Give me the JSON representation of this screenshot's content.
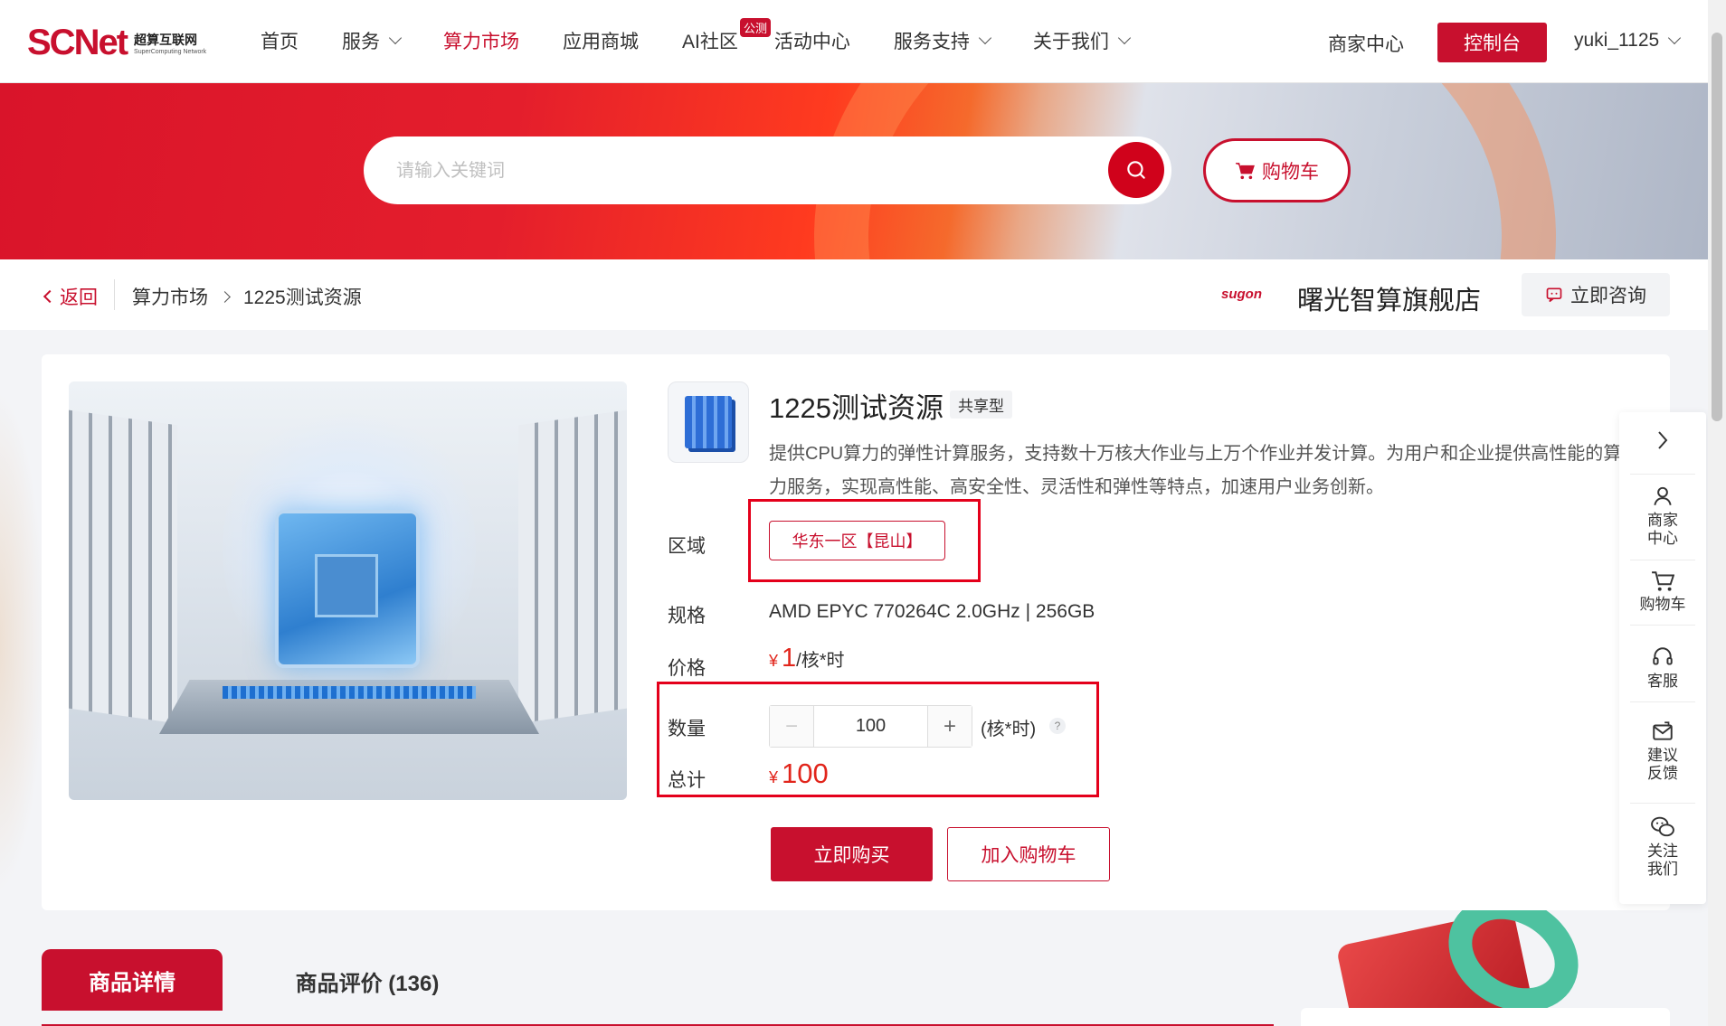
{
  "header": {
    "logo_text": "SCNet",
    "logo_cn": "超算互联网",
    "logo_en": "SuperComputing Network",
    "nav": [
      {
        "label": "首页"
      },
      {
        "label": "服务"
      },
      {
        "label": "算力市场"
      },
      {
        "label": "应用商城"
      },
      {
        "label": "AI社区"
      },
      {
        "label": "活动中心"
      },
      {
        "label": "服务支持"
      },
      {
        "label": "关于我们"
      }
    ],
    "ai_badge": "公测",
    "merchant_center": "商家中心",
    "console": "控制台",
    "username": "yuki_1125"
  },
  "search": {
    "placeholder": "请输入关键词",
    "cart_label": "购物车"
  },
  "breadcrumb": {
    "back": "返回",
    "items": [
      "算力市场",
      "1225测试资源"
    ]
  },
  "store": {
    "logo": "sugon",
    "name": "曙光智算旗舰店",
    "consult": "立即咨询"
  },
  "product": {
    "title": "1225测试资源",
    "type_tag": "共享型",
    "description": "提供CPU算力的弹性计算服务，支持数十万核大作业与上万个作业并发计算。为用户和企业提供高性能的算力服务，实现高性能、高安全性、灵活性和弹性等特点，加速用户业务创新。",
    "region_label": "区域",
    "region_value": "华东一区【昆山】",
    "spec_label": "规格",
    "spec_value": "AMD EPYC 770264C 2.0GHz | 256GB",
    "price_label": "价格",
    "price_currency": "¥",
    "price_value": "1",
    "price_unit": "/核*时",
    "qty_label": "数量",
    "qty_value": "100",
    "qty_unit": "(核*时)",
    "total_label": "总计",
    "total_currency": "¥",
    "total_value": "100",
    "buy_now": "立即购买",
    "add_to_cart": "加入购物车"
  },
  "tabs": [
    {
      "label": "商品详情"
    },
    {
      "label": "商品评价 (136)"
    }
  ],
  "float_bar": [
    {
      "label": "商家\n中心",
      "icon": "user-icon"
    },
    {
      "label": "购物车",
      "icon": "cart-icon"
    },
    {
      "label": "客服",
      "icon": "headset-icon"
    },
    {
      "label": "建议\n反馈",
      "icon": "feedback-icon"
    },
    {
      "label": "关注\n我们",
      "icon": "wechat-icon"
    }
  ],
  "colors": {
    "brand": "#c8102e",
    "price": "#e1251b",
    "highlight_box": "#e4001b"
  }
}
